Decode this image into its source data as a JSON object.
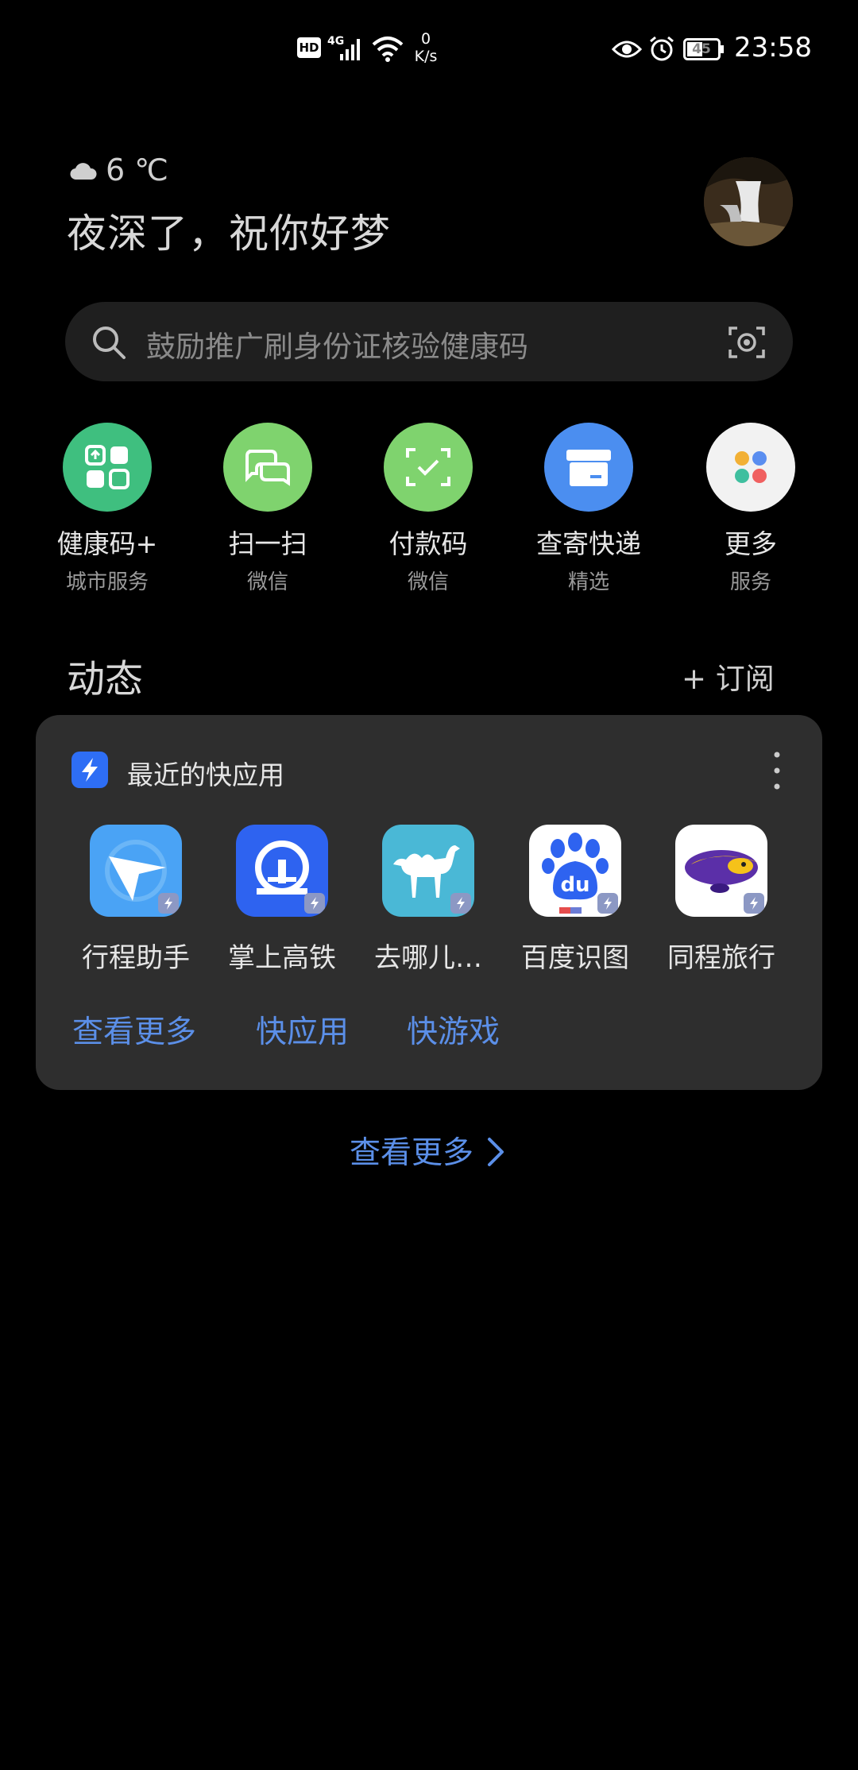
{
  "status_bar": {
    "hd": "HD",
    "network": "4G",
    "speed_value": "0",
    "speed_unit": "K/s",
    "battery": "45",
    "time": "23:58"
  },
  "header": {
    "temperature": "6 ℃",
    "greeting": "夜深了，祝你好梦"
  },
  "search": {
    "placeholder": "鼓励推广刷身份证核验健康码"
  },
  "shortcuts": [
    {
      "label": "健康码+",
      "sub": "城市服务",
      "color": "#3fbf7f"
    },
    {
      "label": "扫一扫",
      "sub": "微信",
      "color": "#7fd36e"
    },
    {
      "label": "付款码",
      "sub": "微信",
      "color": "#7fd36e"
    },
    {
      "label": "查寄快递",
      "sub": "精选",
      "color": "#4b8ef0"
    },
    {
      "label": "更多",
      "sub": "服务",
      "color": "#f2f2f2"
    }
  ],
  "section": {
    "title": "动态",
    "subscribe": "+ 订阅"
  },
  "card": {
    "title": "最近的快应用",
    "apps": [
      {
        "label": "行程助手",
        "icon": "navigation-arrow-icon"
      },
      {
        "label": "掌上高铁",
        "icon": "railway-logo-icon"
      },
      {
        "label": "去哪儿…",
        "icon": "camel-icon"
      },
      {
        "label": "百度识图",
        "icon": "baidu-paw-icon"
      },
      {
        "label": "同程旅行",
        "icon": "airship-icon"
      }
    ],
    "links": [
      "查看更多",
      "快应用",
      "快游戏"
    ]
  },
  "footer": {
    "more": "查看更多"
  }
}
